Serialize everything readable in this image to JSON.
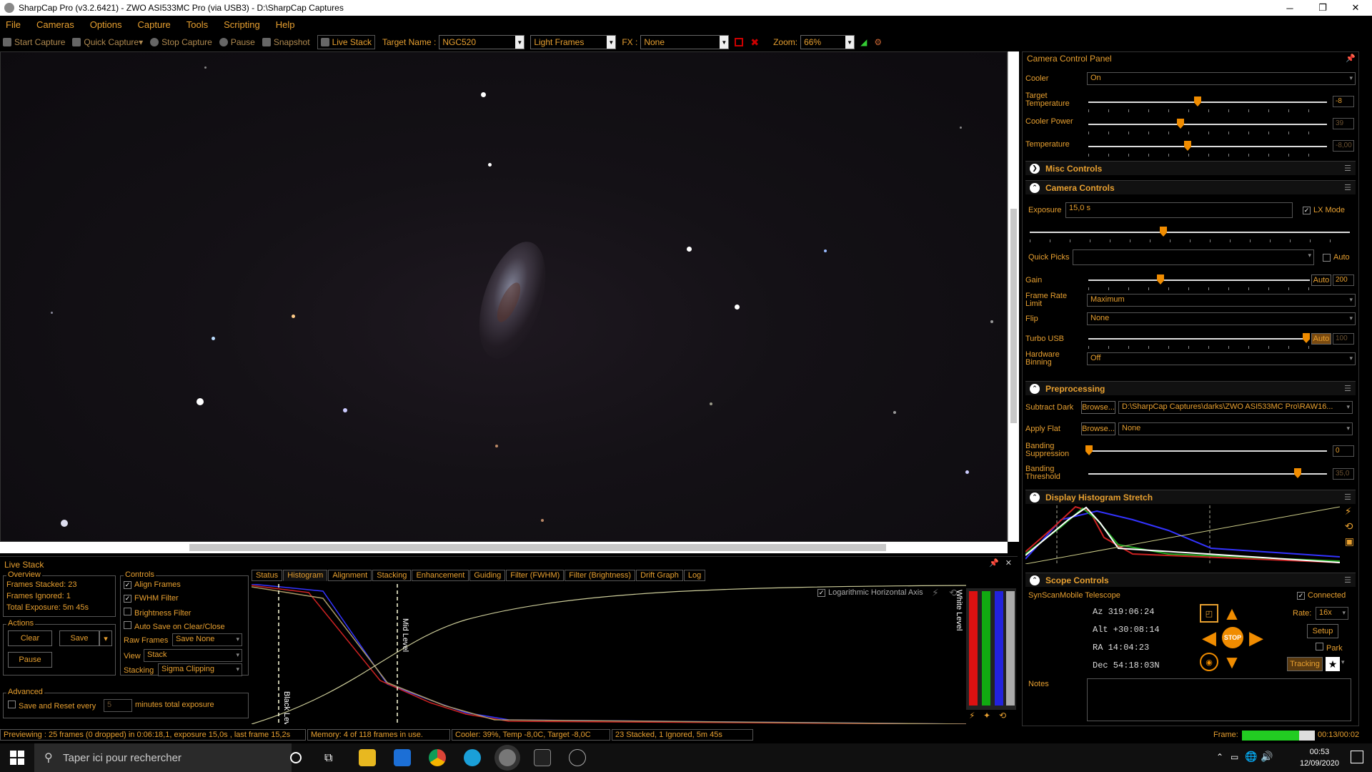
{
  "window": {
    "title": "SharpCap Pro (v3.2.6421) - ZWO ASI533MC Pro (via USB3) - D:\\SharpCap Captures",
    "minimize": "─",
    "maximize": "❐",
    "close": "✕"
  },
  "menu": [
    "File",
    "Cameras",
    "Options",
    "Capture",
    "Tools",
    "Scripting",
    "Help"
  ],
  "toolbar": {
    "start_capture": "Start Capture",
    "quick_capture": "Quick Capture",
    "stop_capture": "Stop Capture",
    "pause": "Pause",
    "snapshot": "Snapshot",
    "live_stack": "Live Stack",
    "target_label": "Target Name :",
    "target_value": "NGC520",
    "frame_type": "Light Frames",
    "fx_label": "FX :",
    "fx_value": "None",
    "zoom_label": "Zoom:",
    "zoom_value": "66%"
  },
  "camera_panel": {
    "title": "Camera Control Panel",
    "cooler_label": "Cooler",
    "cooler_value": "On",
    "target_temp_label": "Target Temperature",
    "target_temp_value": "-8",
    "cooler_power_label": "Cooler Power",
    "cooler_power_value": "39",
    "temperature_label": "Temperature",
    "temperature_value": "-8,00",
    "misc_controls": "Misc Controls",
    "camera_controls": "Camera Controls",
    "exposure_label": "Exposure",
    "exposure_value": "15,0 s",
    "lx_mode": "LX Mode",
    "quick_picks_label": "Quick Picks",
    "auto_label": "Auto",
    "gain_label": "Gain",
    "gain_auto": "Auto",
    "gain_value": "200",
    "frame_rate_label": "Frame Rate Limit",
    "frame_rate_value": "Maximum",
    "flip_label": "Flip",
    "flip_value": "None",
    "turbo_label": "Turbo USB",
    "turbo_auto": "Auto",
    "turbo_value": "100",
    "binning_label": "Hardware Binning",
    "binning_value": "Off",
    "preprocessing": "Preprocessing",
    "subtract_dark_label": "Subtract Dark",
    "browse": "Browse...",
    "dark_path": "D:\\SharpCap Captures\\darks\\ZWO ASI533MC Pro\\RAW16...",
    "apply_flat_label": "Apply Flat",
    "flat_value": "None",
    "banding_supp_label": "Banding Suppression",
    "banding_supp_value": "0",
    "banding_thresh_label": "Banding Threshold",
    "banding_thresh_value": "35,0",
    "histogram_stretch": "Display Histogram Stretch",
    "scope_controls": "Scope Controls",
    "scope_name": "SynScanMobile Telescope",
    "connected": "Connected",
    "az": "Az    319:06:24",
    "alt": "Alt  +30:08:14",
    "ra": "RA    14:04:23",
    "dec": "Dec  54:18:03N",
    "rate_label": "Rate:",
    "rate_value": "16x",
    "setup": "Setup",
    "park": "Park",
    "stop": "STOP",
    "tracking": "Tracking",
    "notes_label": "Notes"
  },
  "live_stack": {
    "title": "Live Stack",
    "overview_title": "Overview",
    "frames_stacked": "Frames Stacked:  23",
    "frames_ignored": "Frames Ignored:   1",
    "total_exposure": "Total Exposure:   5m 45s",
    "actions_title": "Actions",
    "clear": "Clear",
    "save": "Save",
    "pause": "Pause",
    "controls_title": "Controls",
    "align_frames": "Align Frames",
    "fwhm_filter": "FWHM Filter",
    "brightness_filter": "Brightness Filter",
    "auto_save": "Auto Save on Clear/Close",
    "raw_frames_label": "Raw Frames",
    "raw_frames_value": "Save None",
    "view_label": "View",
    "view_value": "Stack",
    "stacking_label": "Stacking",
    "stacking_value": "Sigma Clipping",
    "advanced_title": "Advanced",
    "save_reset": "Save and Reset every",
    "save_reset_value": "5",
    "minutes_label": "minutes total exposure",
    "tabs": [
      "Status",
      "Histogram",
      "Alignment",
      "Stacking",
      "Enhancement",
      "Guiding",
      "Filter (FWHM)",
      "Filter (Brightness)",
      "Drift Graph",
      "Log"
    ],
    "log_axis": "Logarithmic Horizontal Axis",
    "black_level": "Black Level",
    "mid_level": "Mid Level",
    "white_level": "White Level"
  },
  "status": {
    "previewing": "Previewing : 25 frames (0 dropped) in 0:06:18,1, exposure 15,0s , last frame 15,2s",
    "memory": "Memory: 4 of 118 frames in use.",
    "cooler": "Cooler: 39%, Temp -8,0C, Target -8,0C",
    "stacked": "23 Stacked, 1 Ignored, 5m 45s",
    "frame_label": "Frame:",
    "frame_time": "00:13/00:02"
  },
  "taskbar": {
    "search_placeholder": "Taper ici pour rechercher",
    "time": "00:53",
    "date": "12/09/2020"
  }
}
